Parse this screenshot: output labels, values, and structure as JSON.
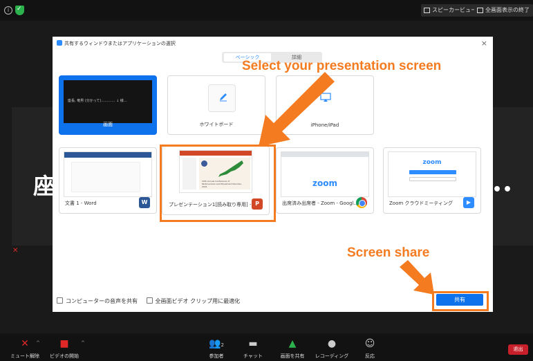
{
  "topbar": {
    "speaker_view_label": "スピーカービュー",
    "exit_fullscreen_label": "全画面表示の終了"
  },
  "background": {
    "name_peek": "座",
    "dots_peek": "••"
  },
  "dialog": {
    "title": "共有するウィンドウまたはアプリケーションの選択",
    "close_glyph": "×",
    "tabs": [
      "ベーシック",
      "詳細"
    ],
    "tiles_row1": [
      {
        "label": "画面",
        "thumb_text": "座長, 竜男 (分かって)………… ↓ 様…"
      },
      {
        "label": "ホワイトボード"
      },
      {
        "label": "iPhone/iPad"
      }
    ],
    "tiles_row2": [
      {
        "label": "文書 1 - Word",
        "app_icon": "W"
      },
      {
        "label": "プレゼンテーション1[読み取り専用] -...",
        "app_icon": "P"
      },
      {
        "label": "出席済み出席者 - Zoom - Googl...",
        "app_icon": "chrome"
      },
      {
        "label": "Zoom クラウドミーティング",
        "app_icon": "zoom"
      }
    ],
    "thumbs": {
      "zoom_logo": "zoom",
      "slide_text": "15th Annual Conference of Parkinsonism and Movement Disorder, 2021"
    },
    "option_audio": "コンピューターの音声を共有",
    "option_video": "全画面ビデオ クリップ用に最適化",
    "share_label": "共有"
  },
  "annotations": {
    "select_text": "Select your presentation screen",
    "share_text": "Screen share",
    "accent_color": "#f47b20"
  },
  "bottombar": {
    "items": [
      {
        "label": "ミュート解除",
        "icon": "mic-off-icon"
      },
      {
        "label": "ビデオの開始",
        "icon": "video-off-icon"
      },
      {
        "label": "参加者",
        "icon": "participants-icon",
        "count": "2"
      },
      {
        "label": "チャット",
        "icon": "chat-icon"
      },
      {
        "label": "画面を共有",
        "icon": "share-screen-icon"
      },
      {
        "label": "レコーディング",
        "icon": "record-icon"
      },
      {
        "label": "反応",
        "icon": "reactions-icon"
      }
    ],
    "leave_label": "退出"
  }
}
